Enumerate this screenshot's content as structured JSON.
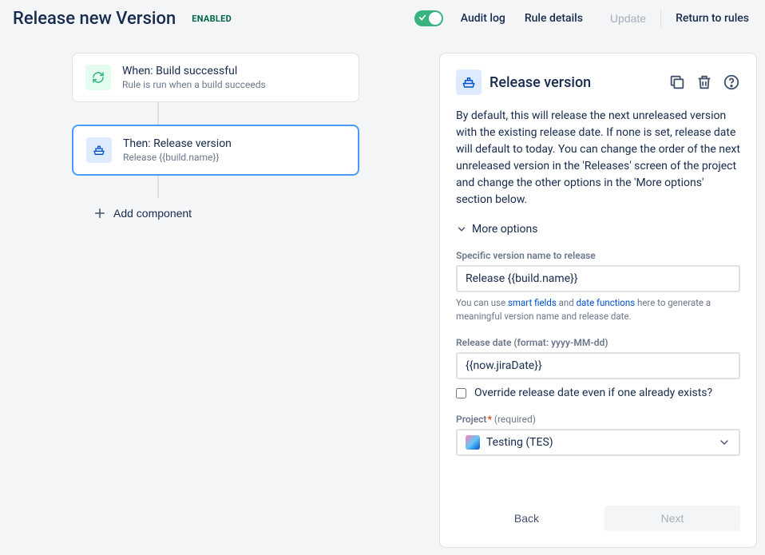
{
  "header": {
    "title": "Release new Version",
    "status_badge": "ENABLED",
    "links": {
      "audit_log": "Audit log",
      "rule_details": "Rule details",
      "update": "Update",
      "return": "Return to rules"
    }
  },
  "flow": {
    "trigger": {
      "title": "When: Build successful",
      "subtitle": "Rule is run when a build succeeds"
    },
    "action": {
      "title": "Then: Release version",
      "subtitle": "Release {{build.name}}"
    },
    "add_component": "Add component"
  },
  "panel": {
    "title": "Release version",
    "description": "By default, this will release the next unreleased version with the existing release date. If none is set, release date will default to today. You can change the order of the next unreleased version in the 'Releases' screen of the project and change the other options in the 'More options' section below.",
    "more_options": "More options",
    "fields": {
      "version_name": {
        "label": "Specific version name to release",
        "value": "Release {{build.name}}",
        "hint_pre": "You can use ",
        "hint_link1": "smart fields",
        "hint_mid": " and ",
        "hint_link2": "date functions",
        "hint_post": " here to generate a meaningful version name and release date."
      },
      "release_date": {
        "label": "Release date (format: yyyy-MM-dd)",
        "value": "{{now.jiraDate}}",
        "override_label": "Override release date even if one already exists?"
      },
      "project": {
        "label": "Project",
        "required_text": "(required)",
        "value": "Testing (TES)"
      }
    },
    "buttons": {
      "back": "Back",
      "next": "Next"
    }
  }
}
